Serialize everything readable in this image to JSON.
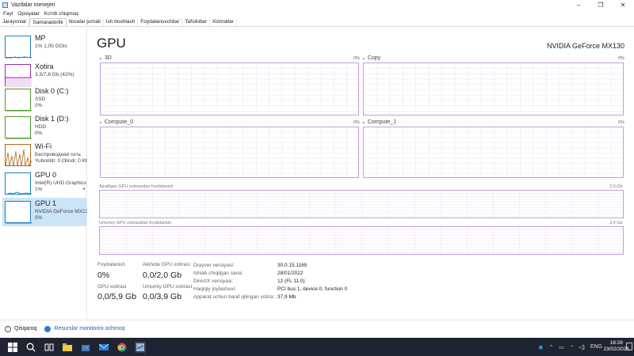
{
  "window": {
    "title": "Vazifalar menejeri",
    "minimize": "–",
    "maximize": "❐",
    "close": "✕"
  },
  "menu": [
    "Fayl",
    "Opsiyalar",
    "Ko‘rib chiqmoq"
  ],
  "tabs": [
    {
      "label": "Jarayonlar",
      "active": false
    },
    {
      "label": "Samaradorlik",
      "active": true
    },
    {
      "label": "Ilovalar jurnali",
      "active": false
    },
    {
      "label": "Ish boshlash",
      "active": false
    },
    {
      "label": "Foydalanuvchilar",
      "active": false
    },
    {
      "label": "Tafsilotlar",
      "active": false
    },
    {
      "label": "Xizmatlar",
      "active": false
    }
  ],
  "sidebar": {
    "items": [
      {
        "name": "MP",
        "lines": [
          "1% 1,05 GGts"
        ],
        "color": "#1a82c7",
        "active": false
      },
      {
        "name": "Xotira",
        "lines": [
          "3,3/7,8 Gb (42%)"
        ],
        "color": "#a02cb0",
        "active": false
      },
      {
        "name": "Disk 0 (C:)",
        "lines": [
          "SSD",
          "0%"
        ],
        "color": "#4c9a2a",
        "active": false
      },
      {
        "name": "Disk 1 (D:)",
        "lines": [
          "HDD",
          "0%"
        ],
        "color": "#4c9a2a",
        "active": false
      },
      {
        "name": "Wi-Fi",
        "lines": [
          "Беспроводная сеть",
          "Yuborildi: 0 Olindi: 0 Kbit/s"
        ],
        "color": "#a86a20",
        "active": false
      },
      {
        "name": "GPU 0",
        "lines": [
          "Intel(R) UHD Graphics",
          "1%"
        ],
        "color": "#1a82c7",
        "active": false
      },
      {
        "name": "GPU 1",
        "lines": [
          "NVIDIA GeForce MX130",
          "0%"
        ],
        "color": "#1a82c7",
        "active": true
      }
    ]
  },
  "main": {
    "title": "GPU",
    "model": "NVIDIA GeForce MX130",
    "engines": [
      {
        "label": "3D",
        "pct": "0%"
      },
      {
        "label": "Copy",
        "pct": "0%"
      },
      {
        "label": "Compute_0",
        "pct": "0%"
      },
      {
        "label": "Compute_1",
        "pct": "0%"
      }
    ],
    "dedicated_mem": {
      "label": "Ajratilgan GPU xotirasidan foydalanish",
      "max": "2,0 Gb"
    },
    "shared_mem": {
      "label": "Umumiy GPU xotirasidan foydalanish",
      "max": "3,9 Gb"
    },
    "stats": {
      "utilization_label": "Foydalanish",
      "utilization_value": "0%",
      "dedicated_label": "Alohida GPU xotirasi",
      "dedicated_value": "0,0/2,0 Gb",
      "gpu_mem_label": "GPU xotirasi",
      "gpu_mem_value": "0,0/5,9 Gb",
      "shared_label": "Umumiy GPU xotirasi",
      "shared_value": "0,0/3,9 Gb"
    },
    "details": [
      {
        "key": "Drayver versiyasi:",
        "value": "30.0.15.1165"
      },
      {
        "key": "Ishlab chiqilgan sana:",
        "value": "28/01/2022"
      },
      {
        "key": "DirectX versiyasi:",
        "value": "12 (FL 11.0)"
      },
      {
        "key": "Haqiqiy joylashuvi:",
        "value": "PCI bus 1, device 0, function 0"
      },
      {
        "key": "Apparat uchun band qilingan xotira:",
        "value": "37,9 Mb"
      }
    ]
  },
  "footer": {
    "fewer_details": "Qisqaroq",
    "resource_monitor": "Resurslar monitorini ochmoq"
  },
  "taskbar": {
    "lang": "ENG",
    "time": "18:28",
    "date": "23/02/2026"
  }
}
